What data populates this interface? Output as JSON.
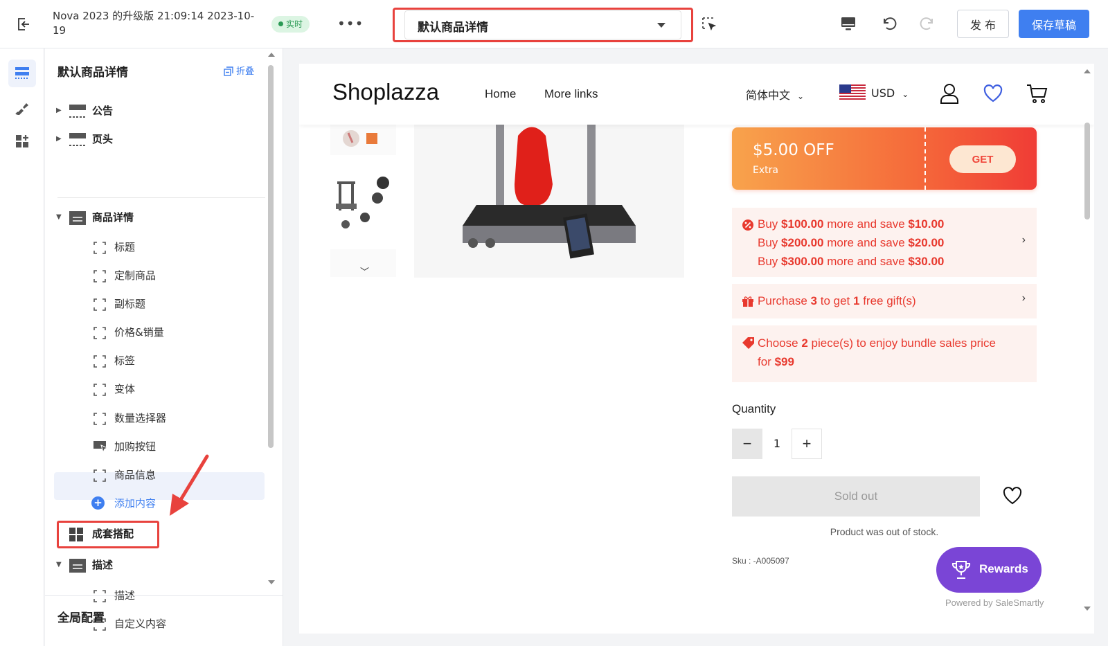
{
  "topbar": {
    "title": "Nova 2023 的升级版 21:09:14 2023-10-19",
    "live_badge": "实时",
    "page_select": "默认商品详情",
    "publish_label": "发 布",
    "save_draft_label": "保存草稿"
  },
  "sidebar": {
    "title": "默认商品详情",
    "collapse_label": "折叠",
    "sections": {
      "announcement": "公告",
      "header": "页头",
      "product_detail": "商品详情",
      "bundle": "成套搭配",
      "description": "描述"
    },
    "product_children": [
      "标题",
      "定制商品",
      "副标题",
      "价格&销量",
      "标签",
      "变体",
      "数量选择器",
      "加购按钮",
      "商品信息"
    ],
    "add_content": "添加内容",
    "description_children": [
      "描述",
      "自定义内容"
    ],
    "global_config": "全局配置"
  },
  "store": {
    "logo": "Shoplazza",
    "nav": [
      "Home",
      "More links"
    ],
    "language": "简体中文",
    "currency": "USD",
    "coupon": {
      "amount": "$5.00 OFF",
      "extra": "Extra",
      "get": "GET"
    },
    "promo_tiers": [
      {
        "pre": "Buy ",
        "buy": "$100.00",
        "mid": " more and save ",
        "save": "$10.00"
      },
      {
        "pre": "Buy ",
        "buy": "$200.00",
        "mid": " more and save ",
        "save": "$20.00"
      },
      {
        "pre": "Buy ",
        "buy": "$300.00",
        "mid": " more and save ",
        "save": "$30.00"
      }
    ],
    "gift": {
      "pre": "Purchase ",
      "qty": "3",
      "mid": " to get ",
      "count": "1",
      "post": " free gift(s)"
    },
    "bundle": {
      "pre": "Choose ",
      "qty": "2",
      "mid": " piece(s) to enjoy bundle sales price",
      "line2_pre": "for ",
      "price": "$99"
    },
    "quantity_label": "Quantity",
    "quantity_value": "1",
    "sold_out": "Sold out",
    "stock_note": "Product was out of stock.",
    "sku": "Sku : -A005097",
    "rewards": "Rewards",
    "powered_by": "Powered by SaleSmartly"
  },
  "colors": {
    "accent": "#3f7ff0",
    "highlight": "#e8423d",
    "promo_red": "#e8392e",
    "rewards_purple": "#7a45d6"
  }
}
